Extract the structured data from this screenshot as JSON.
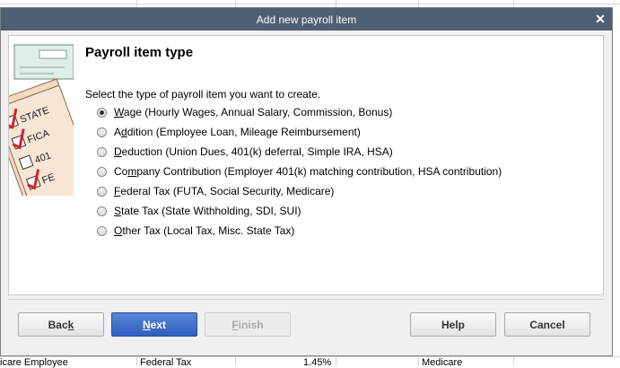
{
  "dialog": {
    "title": "Add new payroll item",
    "close_glyph": "✕",
    "heading": "Payroll item type",
    "prompt": "Select the type of payroll item you want to create.",
    "selected_index": 0,
    "options": [
      {
        "accel": "W",
        "rest": "age (Hourly Wages, Annual Salary, Commission, Bonus)"
      },
      {
        "pre": "A",
        "accel": "d",
        "rest": "dition (Employee Loan, Mileage Reimbursement)"
      },
      {
        "accel": "D",
        "rest": "eduction (Union Dues, 401(k) deferral, Simple IRA, HSA)"
      },
      {
        "pre": "Co",
        "accel": "m",
        "rest": "pany Contribution (Employer 401(k) matching contribution, HSA contribution)"
      },
      {
        "accel": "F",
        "rest": "ederal Tax (FUTA, Social Security, Medicare)"
      },
      {
        "accel": "S",
        "rest": "tate Tax (State Withholding, SDI, SUI)"
      },
      {
        "accel": "O",
        "rest": "ther Tax (Local Tax, Misc. State Tax)"
      }
    ],
    "illustration_labels": [
      "STATE",
      "FICA",
      "401",
      "FE"
    ],
    "buttons": {
      "back": {
        "pre": "Bac",
        "accel": "k"
      },
      "next": {
        "accel": "N",
        "rest": "ext"
      },
      "finish": {
        "accel": "F",
        "rest": "inish"
      },
      "help": "Help",
      "cancel": "Cancel"
    }
  },
  "background_row": {
    "col1": "icare Employee",
    "col2": "Federal Tax",
    "col3": "1.45%",
    "col4": "Medicare"
  },
  "colors": {
    "titlebar": "#4e5f73",
    "primary_button": "#3a6bc9"
  }
}
